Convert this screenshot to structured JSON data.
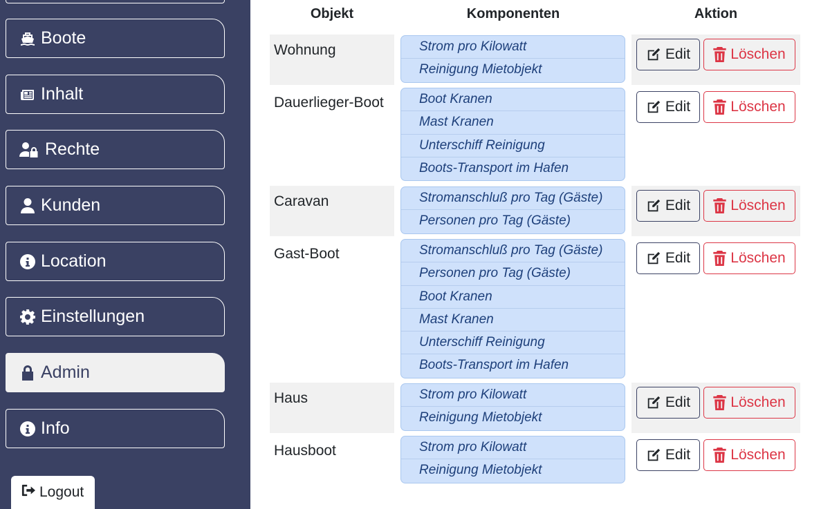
{
  "sidebar": {
    "items": [
      {
        "label": "",
        "icon": "blank"
      },
      {
        "label": "Boote",
        "icon": "ship-icon"
      },
      {
        "label": "Inhalt",
        "icon": "newspaper-icon"
      },
      {
        "label": "Rechte",
        "icon": "user-lock-icon"
      },
      {
        "label": "Kunden",
        "icon": "user-icon"
      },
      {
        "label": "Location",
        "icon": "info-circle-icon"
      },
      {
        "label": "Einstellungen",
        "icon": "gear-icon"
      },
      {
        "label": "Admin",
        "icon": "lock-icon",
        "active": true
      },
      {
        "label": "Info",
        "icon": "info-circle-icon"
      }
    ],
    "logout_label": "Logout"
  },
  "table": {
    "headers": {
      "objekt": "Objekt",
      "komponenten": "Komponenten",
      "aktion": "Aktion"
    },
    "edit_label": "Edit",
    "delete_label": "Löschen",
    "rows": [
      {
        "objekt": "Wohnung",
        "komponenten": [
          "Strom pro Kilowatt",
          "Reinigung Mietobjekt"
        ]
      },
      {
        "objekt": "Dauerlieger-Boot",
        "komponenten": [
          "Boot Kranen",
          "Mast Kranen",
          "Unterschiff Reinigung",
          "Boots-Transport im Hafen"
        ]
      },
      {
        "objekt": "Caravan",
        "komponenten": [
          "Stromanschluß pro Tag (Gäste)",
          "Personen pro Tag (Gäste)"
        ]
      },
      {
        "objekt": "Gast-Boot",
        "komponenten": [
          "Stromanschluß pro Tag (Gäste)",
          "Personen pro Tag (Gäste)",
          "Boot Kranen",
          "Mast Kranen",
          "Unterschiff Reinigung",
          "Boots-Transport im Hafen"
        ]
      },
      {
        "objekt": "Haus",
        "komponenten": [
          "Strom pro Kilowatt",
          "Reinigung Mietobjekt"
        ]
      },
      {
        "objekt": "Hausboot",
        "komponenten": [
          "Strom pro Kilowatt",
          "Reinigung Mietobjekt"
        ]
      }
    ]
  },
  "colors": {
    "sidebar_bg": "#3a4163",
    "danger": "#dc3545",
    "component_bg": "#cfe1fb"
  }
}
